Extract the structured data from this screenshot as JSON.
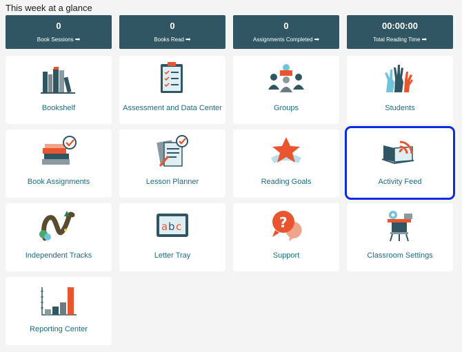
{
  "header": {
    "title": "This week at a glance"
  },
  "stats": [
    {
      "value": "0",
      "label": "Book Sessions",
      "arrow": "➡"
    },
    {
      "value": "0",
      "label": "Books Read",
      "arrow": "➡"
    },
    {
      "value": "0",
      "label": "Assignments Completed",
      "arrow": "➡"
    },
    {
      "value": "00:00:00",
      "label": "Total Reading Time",
      "arrow": "➡"
    }
  ],
  "tiles": [
    {
      "label": "Bookshelf",
      "icon": "bookshelf-icon"
    },
    {
      "label": "Assessment and Data Center",
      "icon": "clipboard-checklist-icon"
    },
    {
      "label": "Groups",
      "icon": "group-reading-icon"
    },
    {
      "label": "Students",
      "icon": "raised-hands-icon"
    },
    {
      "label": "Book Assignments",
      "icon": "book-stack-check-icon"
    },
    {
      "label": "Lesson Planner",
      "icon": "lesson-planner-icon"
    },
    {
      "label": "Reading Goals",
      "icon": "star-icon"
    },
    {
      "label": "Activity Feed",
      "icon": "book-wifi-icon"
    },
    {
      "label": "Independent Tracks",
      "icon": "winding-track-icon"
    },
    {
      "label": "Letter Tray",
      "icon": "abc-board-icon"
    },
    {
      "label": "Support",
      "icon": "question-bubbles-icon"
    },
    {
      "label": "Classroom Settings",
      "icon": "classroom-desk-icon"
    },
    {
      "label": "Reporting Center",
      "icon": "bar-chart-icon"
    }
  ],
  "selected_tile": "Activity Feed",
  "colors": {
    "header_bg": "#2f5662",
    "label": "#1b6b84",
    "accent": "#e9552f",
    "selection": "#0a2be0"
  }
}
